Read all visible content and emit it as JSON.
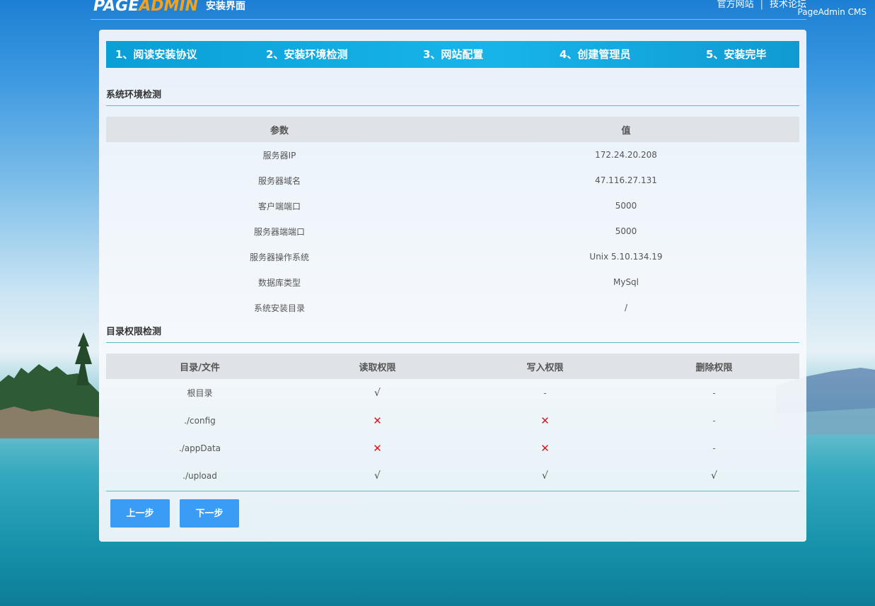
{
  "header": {
    "logo_page": "PAGE",
    "logo_admin": "ADMIN",
    "subtitle": "安装界面",
    "links": [
      "官方网站",
      "技术论坛"
    ],
    "cms_label": "PageAdmin CMS"
  },
  "steps": [
    "1、阅读安装协议",
    "2、安装环境检测",
    "3、网站配置",
    "4、创建管理员",
    "5、安装完毕"
  ],
  "env_section": {
    "title": "系统环境检测",
    "columns": [
      "参数",
      "值"
    ],
    "rows": [
      {
        "param": "服务器IP",
        "value": "172.24.20.208"
      },
      {
        "param": "服务器域名",
        "value": "47.116.27.131"
      },
      {
        "param": "客户端端口",
        "value": "5000"
      },
      {
        "param": "服务器端端口",
        "value": "5000"
      },
      {
        "param": "服务器操作系统",
        "value": "Unix 5.10.134.19"
      },
      {
        "param": "数据库类型",
        "value": "MySql"
      },
      {
        "param": "系统安装目录",
        "value": "/"
      }
    ]
  },
  "perm_section": {
    "title": "目录权限检测",
    "columns": [
      "目录/文件",
      "读取权限",
      "写入权限",
      "删除权限"
    ],
    "rows": [
      {
        "path": "根目录",
        "read": "√",
        "write": "-",
        "delete": "-"
      },
      {
        "path": "./config",
        "read": "✕",
        "write": "✕",
        "delete": "-"
      },
      {
        "path": "./appData",
        "read": "✕",
        "write": "✕",
        "delete": "-"
      },
      {
        "path": "./upload",
        "read": "√",
        "write": "√",
        "delete": "√"
      }
    ]
  },
  "buttons": {
    "prev": "上一步",
    "next": "下一步"
  },
  "colors": {
    "step_bar": "#17b4ea",
    "button": "#3b9cf5",
    "fail_mark": "#e0141e",
    "logo_accent": "#f5a21a"
  }
}
